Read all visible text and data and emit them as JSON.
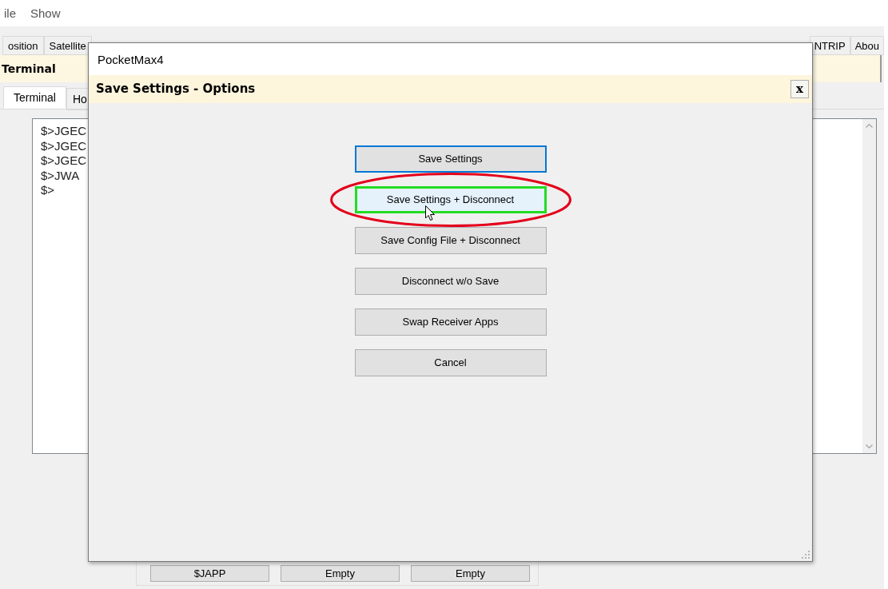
{
  "menu": [
    {
      "label": "ile"
    },
    {
      "label": "Show"
    }
  ],
  "main_tabs": {
    "left": [
      {
        "label": "osition",
        "selected": false
      },
      {
        "label": "Satellite",
        "selected": false
      }
    ],
    "right": [
      {
        "label": "NTRIP",
        "selected": false
      },
      {
        "label": "Abou",
        "selected": false
      }
    ]
  },
  "page_title": "Terminal",
  "sub_tabs": [
    {
      "label": "Terminal",
      "selected": true
    },
    {
      "label": "Ho",
      "selected": false
    }
  ],
  "terminal": {
    "lines": [
      "$>JGEC",
      "$>JGEC",
      "$>JGEC",
      "$>JWA",
      "$>"
    ]
  },
  "quick_buttons": [
    "$JAPP",
    "Empty",
    "Empty"
  ],
  "dialog": {
    "window_title": "PocketMax4",
    "header": "Save Settings - Options",
    "close_label": "x",
    "buttons": [
      {
        "label": "Save Settings",
        "focused": true,
        "hovered": false,
        "circled": false
      },
      {
        "label": "Save Settings + Disconnect",
        "focused": false,
        "hovered": true,
        "circled": true
      },
      {
        "label": "Save Config File + Disconnect",
        "focused": false,
        "hovered": false,
        "circled": false
      },
      {
        "label": "Disconnect w/o Save",
        "focused": false,
        "hovered": false,
        "circled": false
      },
      {
        "label": "Swap Receiver Apps",
        "focused": false,
        "hovered": false,
        "circled": false
      },
      {
        "label": "Cancel",
        "focused": false,
        "hovered": false,
        "circled": false
      }
    ]
  }
}
